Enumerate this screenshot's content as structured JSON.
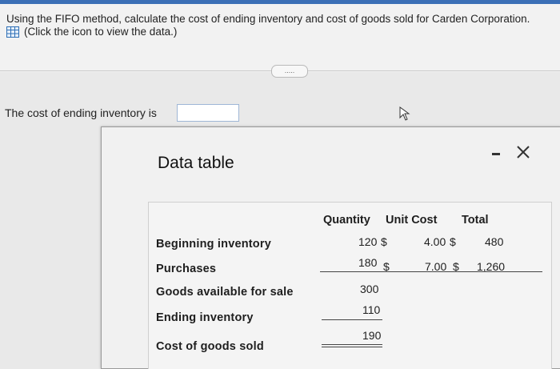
{
  "question": {
    "text": "Using the FIFO method, calculate the cost of ending inventory and cost of goods sold for Carden Corporation.",
    "click_hint": "(Click the icon to view the data.)"
  },
  "more_button": {
    "label": "....."
  },
  "answer": {
    "prompt": "The cost of ending inventory is",
    "value": ""
  },
  "dialog": {
    "title": "Data table",
    "headers": {
      "quantity": "Quantity",
      "unit_cost": "Unit Cost",
      "total": "Total"
    },
    "rows": [
      {
        "label": "Beginning inventory",
        "quantity": "120",
        "qty_suffix": "$",
        "unit_cost": "4.00",
        "uc_suffix": "$",
        "total": "480"
      },
      {
        "label": "Purchases",
        "quantity": "180",
        "qty_suffix": "$",
        "unit_cost": "7.00",
        "uc_suffix": "$",
        "total": "1,260"
      },
      {
        "label": "Goods available for sale",
        "quantity": "300"
      },
      {
        "label": "Ending inventory",
        "quantity": "110"
      },
      {
        "label": "Cost of goods sold",
        "quantity": "190"
      }
    ]
  },
  "colors": {
    "accent": "#3b6fb6",
    "dialog_bg": "#f1f1f1"
  },
  "icons": [
    "table-icon",
    "pointer-cursor-icon",
    "minimize-icon",
    "close-icon"
  ]
}
